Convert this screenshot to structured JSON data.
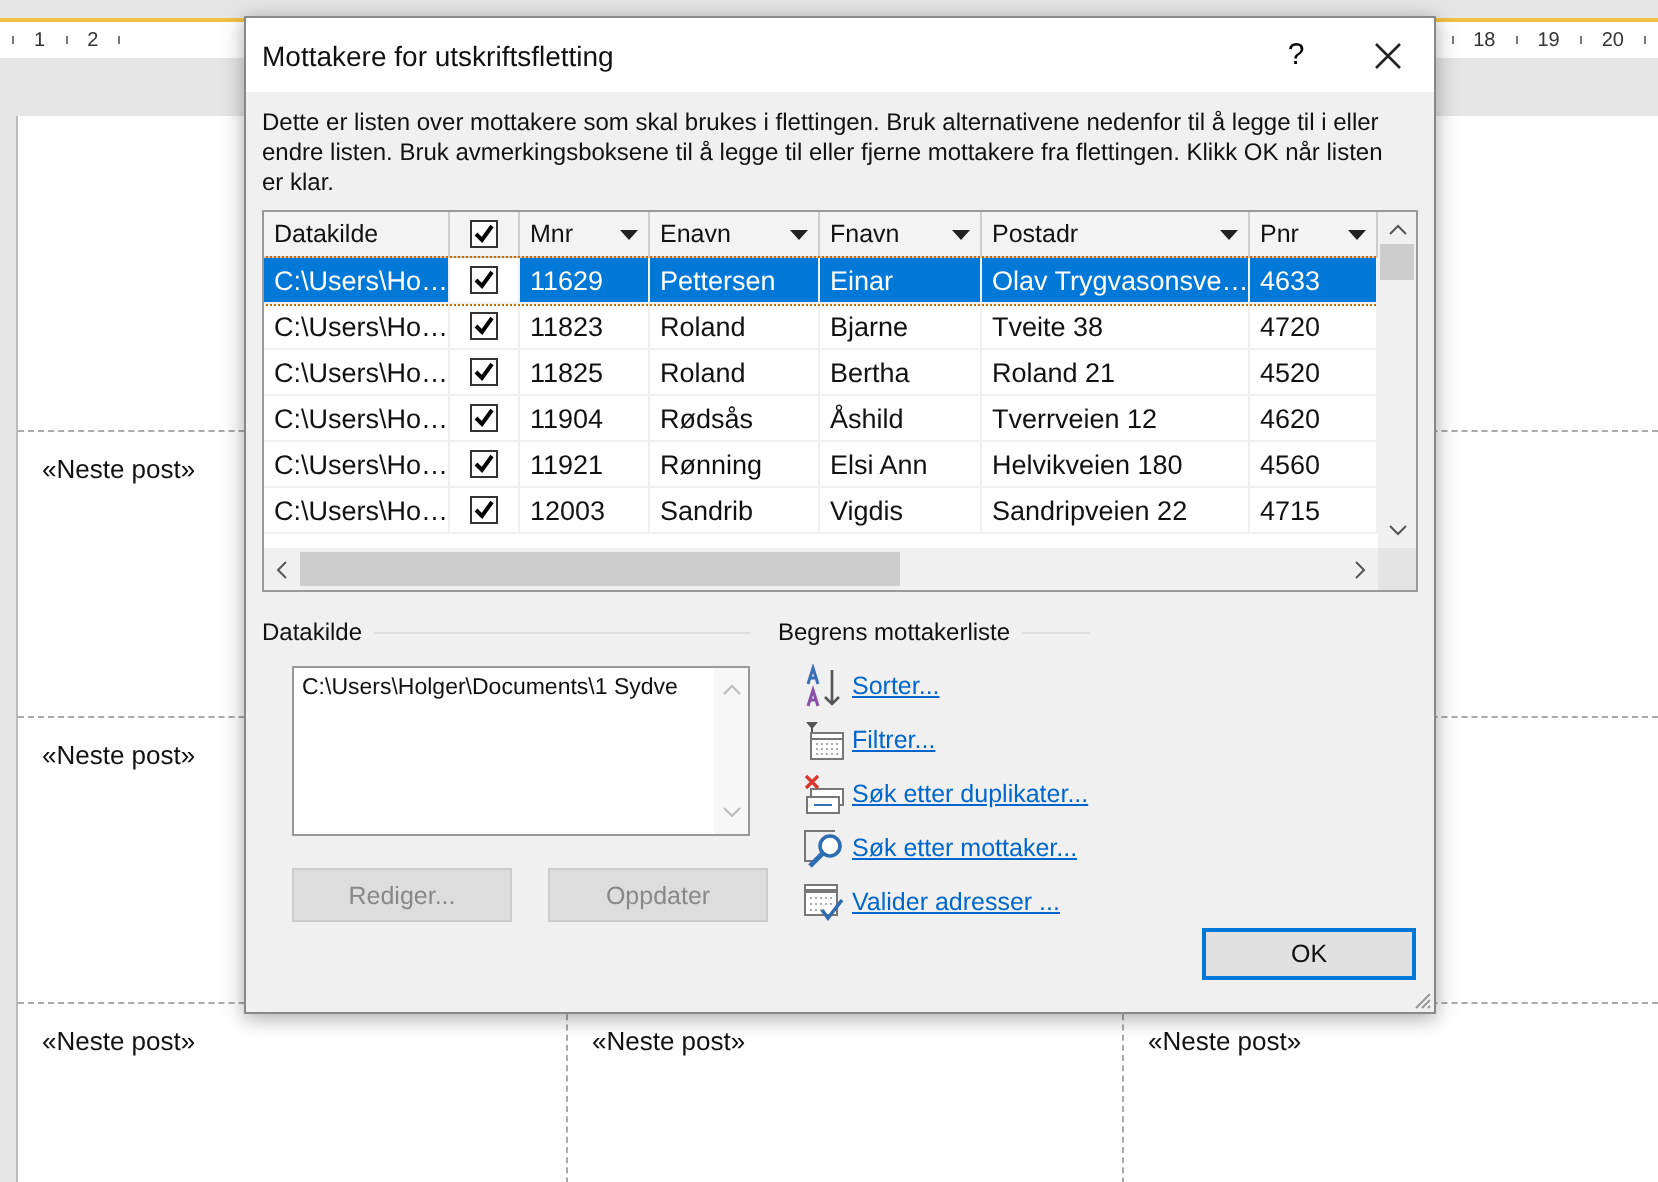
{
  "ruler": {
    "left_numbers": [
      "1",
      "2"
    ],
    "right_numbers": [
      "18",
      "19",
      "20"
    ]
  },
  "document": {
    "label_rows": [
      {},
      {
        "labels": [
          "«Neste post»"
        ]
      },
      {
        "labels": [
          "«Neste post»"
        ]
      },
      {
        "labels": [
          "«Neste post»",
          "«Neste post»",
          "«Neste post»"
        ]
      }
    ]
  },
  "dialog": {
    "title": "Mottakere for utskriftsfletting",
    "help": "?",
    "intro": "Dette er listen over mottakere som skal brukes i flettingen. Bruk alternativene nedenfor til å legge til i eller endre listen. Bruk avmerkingsboksene til å legge til eller fjerne mottakere fra flettingen. Klikk OK når listen er klar.",
    "table": {
      "columns": [
        {
          "kind": "text",
          "label": "Datakilde",
          "dropdown": false
        },
        {
          "kind": "check",
          "checked": true
        },
        {
          "kind": "text",
          "label": "Mnr",
          "dropdown": true
        },
        {
          "kind": "text",
          "label": "Enavn",
          "dropdown": true
        },
        {
          "kind": "text",
          "label": "Fnavn",
          "dropdown": true
        },
        {
          "kind": "text",
          "label": "Postadr",
          "dropdown": true
        },
        {
          "kind": "text",
          "label": "Pnr",
          "dropdown": true
        }
      ],
      "rows": [
        {
          "selected": true,
          "checked": true,
          "cells": [
            "C:\\Users\\Ho…",
            "",
            "11629",
            "Pettersen",
            "Einar",
            "Olav Trygvasonsve…",
            "4633"
          ]
        },
        {
          "selected": false,
          "checked": true,
          "cells": [
            "C:\\Users\\Ho…",
            "",
            "11823",
            "Roland",
            "Bjarne",
            "Tveite 38",
            "4720"
          ]
        },
        {
          "selected": false,
          "checked": true,
          "cells": [
            "C:\\Users\\Ho…",
            "",
            "11825",
            "Roland",
            "Bertha",
            "Roland 21",
            "4520"
          ]
        },
        {
          "selected": false,
          "checked": true,
          "cells": [
            "C:\\Users\\Ho…",
            "",
            "11904",
            "Rødsås",
            "Åshild",
            "Tverrveien 12",
            "4620"
          ]
        },
        {
          "selected": false,
          "checked": true,
          "cells": [
            "C:\\Users\\Ho…",
            "",
            "11921",
            "Rønning",
            "Elsi Ann",
            "Helvikveien 180",
            "4560"
          ]
        },
        {
          "selected": false,
          "checked": true,
          "cells": [
            "C:\\Users\\Ho…",
            "",
            "12003",
            "Sandrib",
            "Vigdis",
            "Sandripveien 22",
            "4715"
          ]
        }
      ]
    },
    "source": {
      "heading": "Datakilde",
      "items": [
        "C:\\Users\\Holger\\Documents\\1 Sydve"
      ],
      "buttons": [
        {
          "label": "Rediger...",
          "disabled": true
        },
        {
          "label": "Oppdater",
          "disabled": true
        }
      ]
    },
    "refine": {
      "heading": "Begrens mottakerliste",
      "links": [
        {
          "kind": "sort",
          "label": "Sorter..."
        },
        {
          "kind": "filter",
          "label": "Filtrer..."
        },
        {
          "kind": "duplicates",
          "label": "Søk etter duplikater..."
        },
        {
          "kind": "find",
          "label": "Søk etter mottaker..."
        },
        {
          "kind": "validate",
          "label": "Valider adresser ..."
        }
      ]
    },
    "ok_button": {
      "label": "OK",
      "default": true
    }
  }
}
